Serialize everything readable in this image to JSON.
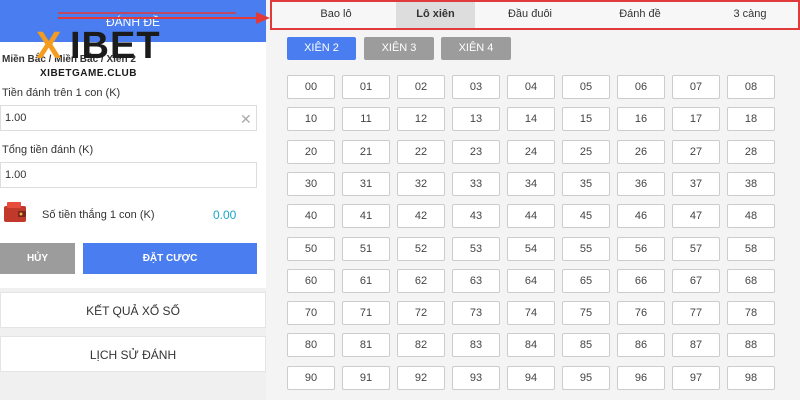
{
  "left_panel": {
    "header_title": "ĐÁNH ĐỀ",
    "breadcrumb": "Miền Bắc / Miền Bắc / Xiên 2",
    "stake_label": "Tiền đánh trên 1 con (K)",
    "stake_value": "1.00",
    "total_label": "Tổng tiền đánh (K)",
    "total_value": "1.00",
    "win_label": "Số tiền thắng 1 con (K)",
    "win_value": "0.00",
    "cancel_label": "HỦY",
    "bet_label": "ĐẶT CƯỢC",
    "results_label": "KẾT QUẢ XỔ SỐ",
    "history_label": "LỊCH SỬ ĐÁNH"
  },
  "logo": {
    "x_letter": "X",
    "brand": "IBET",
    "domain": "XIBETGAME.CLUB"
  },
  "tabs": [
    {
      "label": "Bao lô",
      "active": false
    },
    {
      "label": "Lô xiên",
      "active": true
    },
    {
      "label": "Đầu đuôi",
      "active": false
    },
    {
      "label": "Đánh đề",
      "active": false
    },
    {
      "label": "3 càng",
      "active": false
    }
  ],
  "xien_buttons": [
    {
      "label": "XIÊN 2",
      "active": true
    },
    {
      "label": "XIÊN 3",
      "active": false
    },
    {
      "label": "XIÊN 4",
      "active": false
    }
  ],
  "numbers": [
    "00",
    "01",
    "02",
    "03",
    "04",
    "05",
    "06",
    "07",
    "08",
    "10",
    "11",
    "12",
    "13",
    "14",
    "15",
    "16",
    "17",
    "18",
    "20",
    "21",
    "22",
    "23",
    "24",
    "25",
    "26",
    "27",
    "28",
    "30",
    "31",
    "32",
    "33",
    "34",
    "35",
    "36",
    "37",
    "38",
    "40",
    "41",
    "42",
    "43",
    "44",
    "45",
    "46",
    "47",
    "48",
    "50",
    "51",
    "52",
    "53",
    "54",
    "55",
    "56",
    "57",
    "58",
    "60",
    "61",
    "62",
    "63",
    "64",
    "65",
    "66",
    "67",
    "68",
    "70",
    "71",
    "72",
    "73",
    "74",
    "75",
    "76",
    "77",
    "78",
    "80",
    "81",
    "82",
    "83",
    "84",
    "85",
    "86",
    "87",
    "88",
    "90",
    "91",
    "92",
    "93",
    "94",
    "95",
    "96",
    "97",
    "98"
  ],
  "colors": {
    "primary": "#4a7ef0",
    "cancel": "#9c9c9c",
    "highlight_border": "#e03a3a",
    "logo_orange": "#f39c1f"
  }
}
